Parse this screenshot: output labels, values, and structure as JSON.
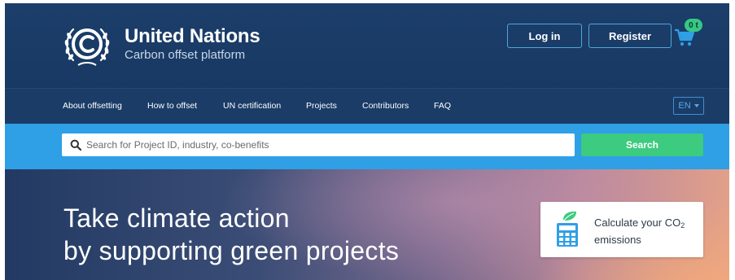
{
  "header": {
    "brand_title": "United Nations",
    "brand_subtitle": "Carbon offset platform",
    "login_label": "Log in",
    "register_label": "Register",
    "cart_badge": "0 t"
  },
  "nav": {
    "items": [
      {
        "label": "About offsetting"
      },
      {
        "label": "How to offset"
      },
      {
        "label": "UN certification"
      },
      {
        "label": "Projects"
      },
      {
        "label": "Contributors"
      },
      {
        "label": "FAQ"
      }
    ],
    "language": "EN"
  },
  "search": {
    "placeholder": "Search for Project ID, industry, co-benefits",
    "button_label": "Search"
  },
  "hero": {
    "line1": "Take climate action",
    "line2": "by supporting green projects",
    "calc_line1": "Calculate your CO",
    "calc_sub": "2",
    "calc_line2": "emissions"
  },
  "icons": {
    "logo": "un-climate-logo-icon",
    "cart": "cart-icon",
    "search": "search-icon",
    "calculator": "calculator-icon",
    "language_caret": "chevron-down-icon"
  },
  "colors": {
    "header_bg": "#1c3e6a",
    "search_band": "#2f9fe6",
    "search_button": "#3ccb7f",
    "accent_outline": "#4fa6e0",
    "badge": "#37c785"
  }
}
